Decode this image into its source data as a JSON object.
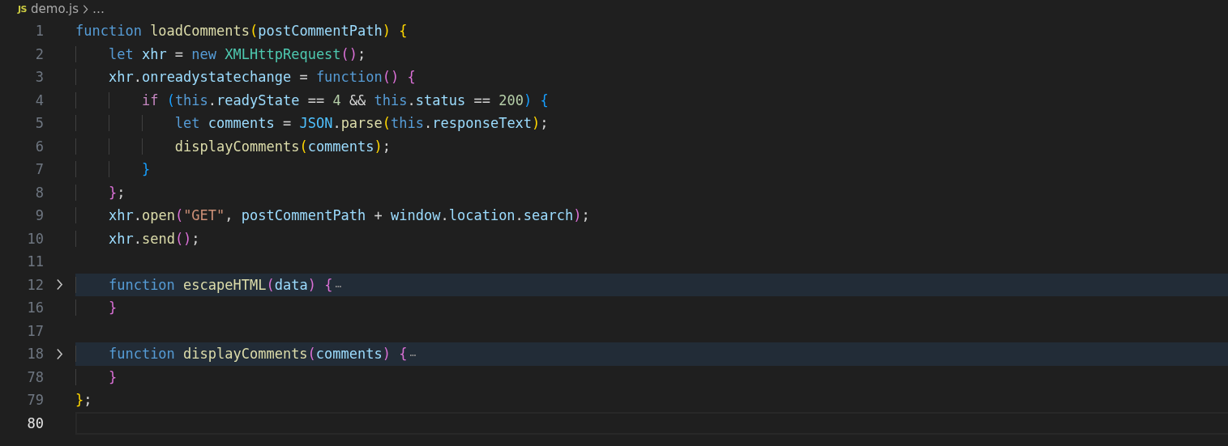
{
  "breadcrumb": {
    "file_badge": "JS",
    "file": "demo.js",
    "more": "…"
  },
  "lines": [
    {
      "number": "1",
      "folded": false,
      "highlighted": false,
      "current": false,
      "tokens": [
        {
          "text": "function ",
          "kind": "kw"
        },
        {
          "text": "loadComments",
          "kind": "fn"
        },
        {
          "text": "(",
          "kind": "br1"
        },
        {
          "text": "postCommentPath",
          "kind": "var"
        },
        {
          "text": ")",
          "kind": "br1"
        },
        {
          "text": " {",
          "kind": "br1"
        }
      ]
    },
    {
      "number": "2",
      "folded": false,
      "highlighted": false,
      "current": false,
      "tokens": [
        {
          "text": "    let ",
          "kind": "kw"
        },
        {
          "text": "xhr",
          "kind": "var"
        },
        {
          "text": " = ",
          "kind": "plain"
        },
        {
          "text": "new ",
          "kind": "kw"
        },
        {
          "text": "XMLHttpRequest",
          "kind": "cls"
        },
        {
          "text": "()",
          "kind": "br2"
        },
        {
          "text": ";",
          "kind": "plain"
        }
      ]
    },
    {
      "number": "3",
      "folded": false,
      "highlighted": false,
      "current": false,
      "tokens": [
        {
          "text": "    xhr",
          "kind": "var"
        },
        {
          "text": ".",
          "kind": "plain"
        },
        {
          "text": "onreadystatechange",
          "kind": "var"
        },
        {
          "text": " = ",
          "kind": "plain"
        },
        {
          "text": "function",
          "kind": "kw"
        },
        {
          "text": "()",
          "kind": "br2"
        },
        {
          "text": " {",
          "kind": "br2"
        }
      ]
    },
    {
      "number": "4",
      "folded": false,
      "highlighted": false,
      "current": false,
      "tokens": [
        {
          "text": "        if ",
          "kind": "ctl"
        },
        {
          "text": "(",
          "kind": "br3"
        },
        {
          "text": "this",
          "kind": "kw"
        },
        {
          "text": ".",
          "kind": "plain"
        },
        {
          "text": "readyState",
          "kind": "var"
        },
        {
          "text": " == ",
          "kind": "plain"
        },
        {
          "text": "4",
          "kind": "num"
        },
        {
          "text": " && ",
          "kind": "plain"
        },
        {
          "text": "this",
          "kind": "kw"
        },
        {
          "text": ".",
          "kind": "plain"
        },
        {
          "text": "status",
          "kind": "var"
        },
        {
          "text": " == ",
          "kind": "plain"
        },
        {
          "text": "200",
          "kind": "num"
        },
        {
          "text": ")",
          "kind": "br3"
        },
        {
          "text": " {",
          "kind": "br3"
        }
      ]
    },
    {
      "number": "5",
      "folded": false,
      "highlighted": false,
      "current": false,
      "tokens": [
        {
          "text": "            let ",
          "kind": "kw"
        },
        {
          "text": "comments",
          "kind": "var"
        },
        {
          "text": " = ",
          "kind": "plain"
        },
        {
          "text": "JSON",
          "kind": "const"
        },
        {
          "text": ".",
          "kind": "plain"
        },
        {
          "text": "parse",
          "kind": "fn"
        },
        {
          "text": "(",
          "kind": "br1"
        },
        {
          "text": "this",
          "kind": "kw"
        },
        {
          "text": ".",
          "kind": "plain"
        },
        {
          "text": "responseText",
          "kind": "var"
        },
        {
          "text": ")",
          "kind": "br1"
        },
        {
          "text": ";",
          "kind": "plain"
        }
      ]
    },
    {
      "number": "6",
      "folded": false,
      "highlighted": false,
      "current": false,
      "tokens": [
        {
          "text": "            displayComments",
          "kind": "fn"
        },
        {
          "text": "(",
          "kind": "br1"
        },
        {
          "text": "comments",
          "kind": "var"
        },
        {
          "text": ")",
          "kind": "br1"
        },
        {
          "text": ";",
          "kind": "plain"
        }
      ]
    },
    {
      "number": "7",
      "folded": false,
      "highlighted": false,
      "current": false,
      "tokens": [
        {
          "text": "        }",
          "kind": "br3"
        }
      ]
    },
    {
      "number": "8",
      "folded": false,
      "highlighted": false,
      "current": false,
      "tokens": [
        {
          "text": "    }",
          "kind": "br2"
        },
        {
          "text": ";",
          "kind": "plain"
        }
      ]
    },
    {
      "number": "9",
      "folded": false,
      "highlighted": false,
      "current": false,
      "tokens": [
        {
          "text": "    xhr",
          "kind": "var"
        },
        {
          "text": ".",
          "kind": "plain"
        },
        {
          "text": "open",
          "kind": "fn"
        },
        {
          "text": "(",
          "kind": "br2"
        },
        {
          "text": "\"GET\"",
          "kind": "str"
        },
        {
          "text": ", ",
          "kind": "plain"
        },
        {
          "text": "postCommentPath",
          "kind": "var"
        },
        {
          "text": " + ",
          "kind": "plain"
        },
        {
          "text": "window",
          "kind": "var"
        },
        {
          "text": ".",
          "kind": "plain"
        },
        {
          "text": "location",
          "kind": "var"
        },
        {
          "text": ".",
          "kind": "plain"
        },
        {
          "text": "search",
          "kind": "var"
        },
        {
          "text": ")",
          "kind": "br2"
        },
        {
          "text": ";",
          "kind": "plain"
        }
      ]
    },
    {
      "number": "10",
      "folded": false,
      "highlighted": false,
      "current": false,
      "tokens": [
        {
          "text": "    xhr",
          "kind": "var"
        },
        {
          "text": ".",
          "kind": "plain"
        },
        {
          "text": "send",
          "kind": "fn"
        },
        {
          "text": "()",
          "kind": "br2"
        },
        {
          "text": ";",
          "kind": "plain"
        }
      ]
    },
    {
      "number": "11",
      "folded": false,
      "highlighted": false,
      "current": false
    },
    {
      "number": "12",
      "folded": true,
      "highlighted": true,
      "current": false,
      "tokens": [
        {
          "text": "    function ",
          "kind": "kw"
        },
        {
          "text": "escapeHTML",
          "kind": "fn"
        },
        {
          "text": "(",
          "kind": "br2"
        },
        {
          "text": "data",
          "kind": "var"
        },
        {
          "text": ")",
          "kind": "br2"
        },
        {
          "text": " {",
          "kind": "br2"
        },
        {
          "text": "⋯",
          "kind": "fold"
        }
      ]
    },
    {
      "number": "16",
      "folded": false,
      "highlighted": false,
      "current": false,
      "tokens": [
        {
          "text": "    }",
          "kind": "br2"
        }
      ]
    },
    {
      "number": "17",
      "folded": false,
      "highlighted": false,
      "current": false
    },
    {
      "number": "18",
      "folded": true,
      "highlighted": true,
      "current": false,
      "tokens": [
        {
          "text": "    function ",
          "kind": "kw"
        },
        {
          "text": "displayComments",
          "kind": "fn"
        },
        {
          "text": "(",
          "kind": "br2"
        },
        {
          "text": "comments",
          "kind": "var"
        },
        {
          "text": ")",
          "kind": "br2"
        },
        {
          "text": " {",
          "kind": "br2"
        },
        {
          "text": "⋯",
          "kind": "fold"
        }
      ]
    },
    {
      "number": "78",
      "folded": false,
      "highlighted": false,
      "current": false,
      "tokens": [
        {
          "text": "    }",
          "kind": "br2"
        }
      ]
    },
    {
      "number": "79",
      "folded": false,
      "highlighted": false,
      "current": false,
      "tokens": [
        {
          "text": "}",
          "kind": "br1"
        },
        {
          "text": ";",
          "kind": "plain"
        }
      ]
    },
    {
      "number": "80",
      "folded": false,
      "highlighted": false,
      "current": true
    }
  ]
}
